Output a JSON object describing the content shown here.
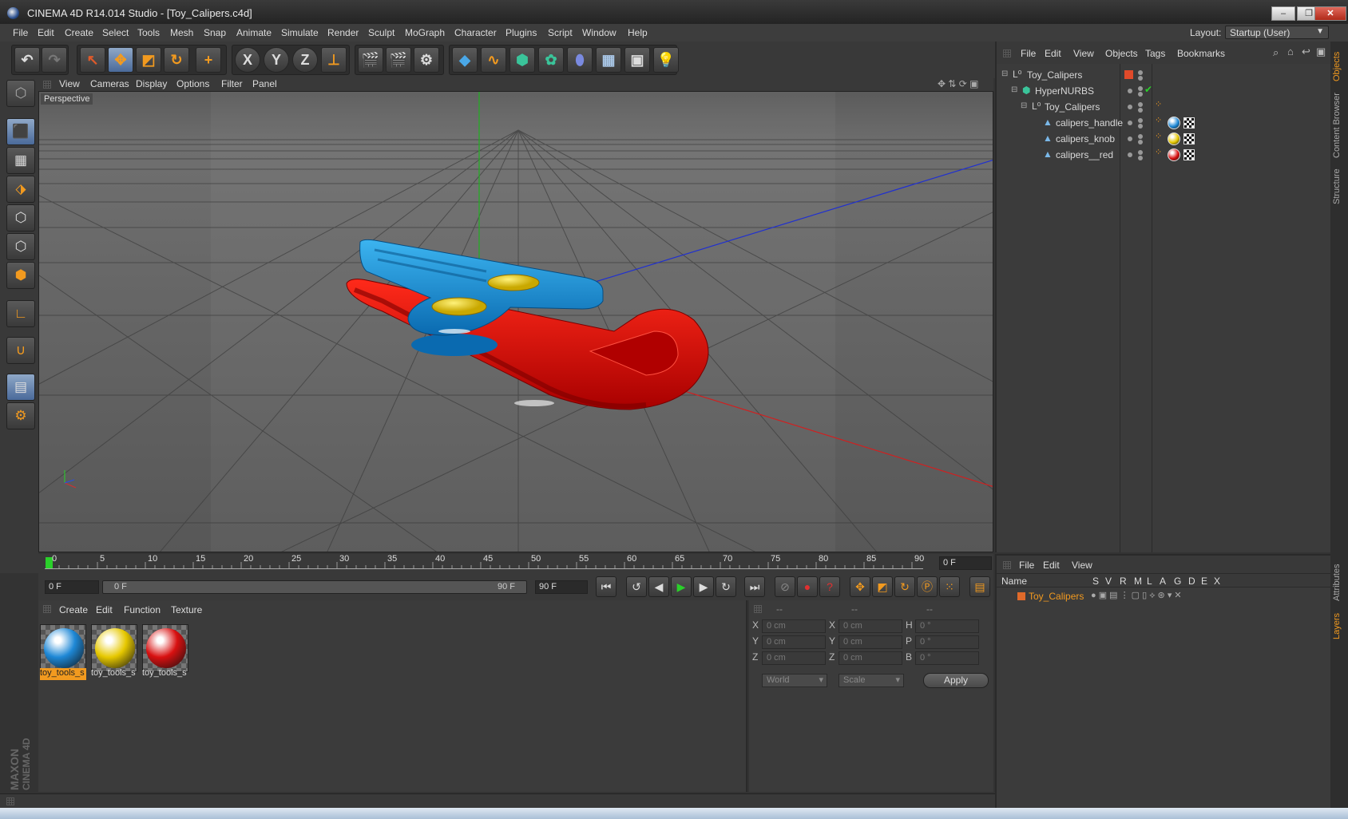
{
  "window": {
    "title": "CINEMA 4D R14.014 Studio - [Toy_Calipers.c4d]",
    "minimize": "–",
    "restore": "❐",
    "close": "✕"
  },
  "menu": [
    "File",
    "Edit",
    "Create",
    "Select",
    "Tools",
    "Mesh",
    "Snap",
    "Animate",
    "Simulate",
    "Render",
    "Sculpt",
    "MoGraph",
    "Character",
    "Plugins",
    "Script",
    "Window",
    "Help"
  ],
  "layout": {
    "label": "Layout:",
    "value": "Startup (User)"
  },
  "viewport": {
    "menu": [
      "View",
      "Cameras",
      "Display",
      "Options",
      "Filter",
      "Panel"
    ],
    "label": "Perspective"
  },
  "object_manager": {
    "menu": [
      "File",
      "Edit",
      "View",
      "Objects",
      "Tags",
      "Bookmarks"
    ],
    "objects": [
      {
        "name": "Toy_Calipers",
        "icon": "null-object-icon"
      },
      {
        "name": "HyperNURBS",
        "icon": "hypernurbs-icon"
      },
      {
        "name": "Toy_Calipers",
        "icon": "null-object-icon"
      },
      {
        "name": "calipers_handle",
        "icon": "polygon-object-icon",
        "material_color": "#1e88d6"
      },
      {
        "name": "calipers_knob",
        "icon": "polygon-object-icon",
        "material_color": "#e6c800"
      },
      {
        "name": "calipers__red",
        "icon": "polygon-object-icon",
        "material_color": "#d81010"
      }
    ]
  },
  "timeline": {
    "ticks": [
      "0",
      "5",
      "10",
      "15",
      "20",
      "25",
      "30",
      "35",
      "40",
      "45",
      "50",
      "55",
      "60",
      "65",
      "70",
      "75",
      "80",
      "85",
      "90"
    ],
    "current_frame": "0 F",
    "start_frame": "0 F",
    "range_start": "0 F",
    "range_end": "90 F",
    "end_frame": "90 F"
  },
  "material_manager": {
    "menu": [
      "Create",
      "Edit",
      "Function",
      "Texture"
    ],
    "materials": [
      {
        "name": "toy_tools_s",
        "color": "#1e88d6",
        "selected": true
      },
      {
        "name": "toy_tools_s",
        "color": "#e6c800",
        "selected": false
      },
      {
        "name": "toy_tools_s",
        "color": "#d81010",
        "selected": false
      }
    ]
  },
  "coordinates": {
    "headers": [
      "--",
      "--",
      "--"
    ],
    "rows": [
      {
        "pos_label": "X",
        "pos": "0 cm",
        "size_label": "X",
        "size": "0 cm",
        "rot_label": "H",
        "rot": "0 °"
      },
      {
        "pos_label": "Y",
        "pos": "0 cm",
        "size_label": "Y",
        "size": "0 cm",
        "rot_label": "P",
        "rot": "0 °"
      },
      {
        "pos_label": "Z",
        "pos": "0 cm",
        "size_label": "Z",
        "size": "0 cm",
        "rot_label": "B",
        "rot": "0 °"
      }
    ],
    "mode": "World",
    "size_mode": "Scale",
    "apply": "Apply"
  },
  "layer_manager": {
    "menu": [
      "File",
      "Edit",
      "View"
    ],
    "columns": [
      "Name",
      "S",
      "V",
      "R",
      "M",
      "L",
      "A",
      "G",
      "D",
      "E",
      "X"
    ],
    "layers": [
      {
        "name": "Toy_Calipers",
        "color": "#e06a2a"
      }
    ]
  },
  "side_tabs": [
    "Objects",
    "Content Browser",
    "Structure"
  ],
  "side_tabs_bottom": [
    "Attributes",
    "Layers"
  ],
  "brand": {
    "line1": "MAXON",
    "line2": "CINEMA 4D"
  },
  "colors": {
    "accent_orange": "#f29a1f",
    "selection_blue": "#4a6a9a",
    "axis_x": "#c03030",
    "axis_y": "#30a030",
    "axis_z": "#3050c0"
  }
}
